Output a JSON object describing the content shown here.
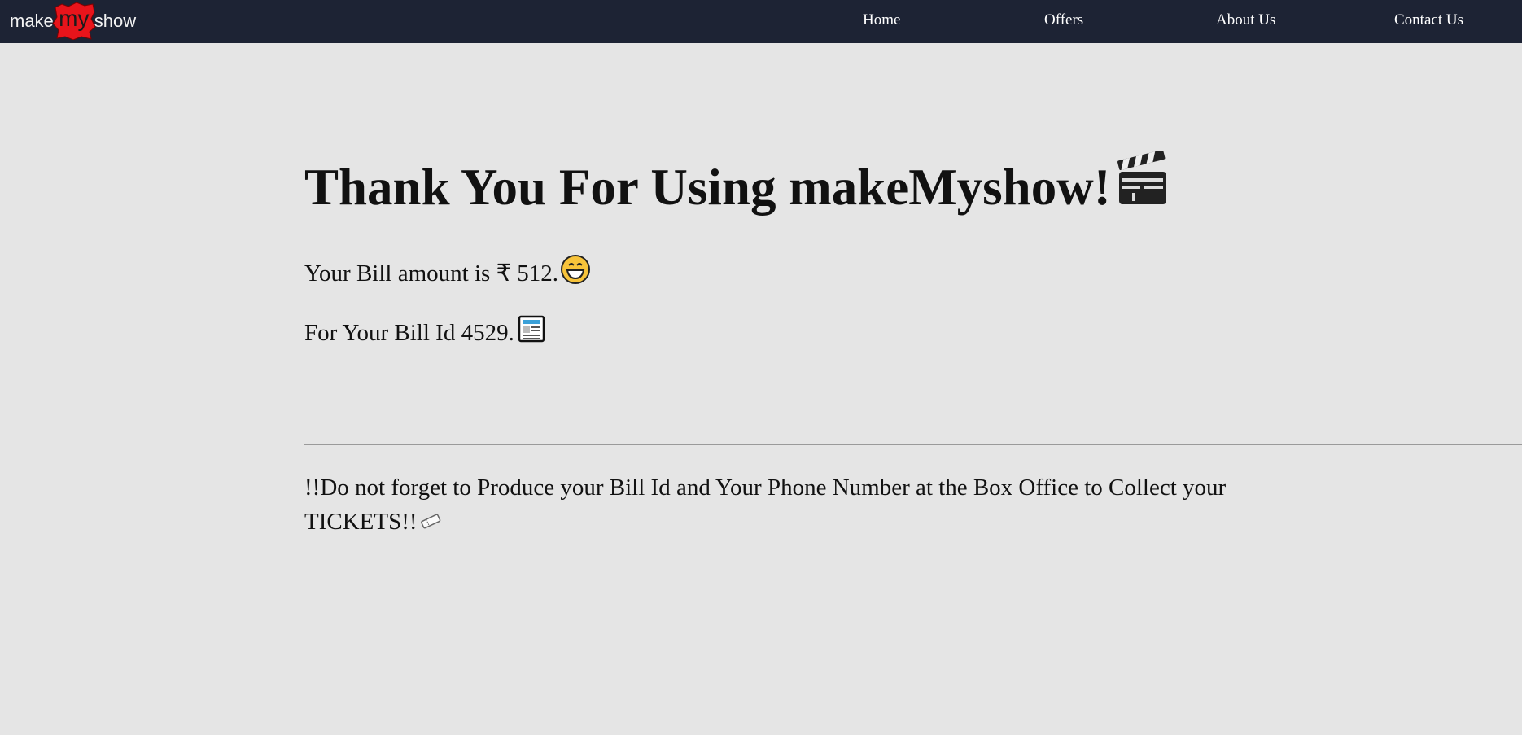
{
  "header": {
    "logo": {
      "part1": "make",
      "part2": "my",
      "part3": "show"
    },
    "nav": [
      {
        "label": "Home"
      },
      {
        "label": "Offers"
      },
      {
        "label": "About Us"
      },
      {
        "label": "Contact Us"
      }
    ]
  },
  "main": {
    "title": "Thank You For Using makeMyshow!",
    "bill_amount_text": "Your Bill amount is ₹ 512.",
    "bill_id_text": "For Your Bill Id 4529.",
    "reminder_text": "!!Do not forget to Produce your Bill Id and Your Phone Number at the Box Office to Collect your TICKETS!!"
  },
  "icons": {
    "title_icon": "clapper-board-icon",
    "amount_icon": "grinning-face-icon",
    "bill_icon": "newspaper-icon",
    "tickets_icon": "ticket-icon"
  },
  "colors": {
    "navbar": "#1d2334",
    "background": "#e5e5e5",
    "logo_accent": "#e8141b"
  }
}
